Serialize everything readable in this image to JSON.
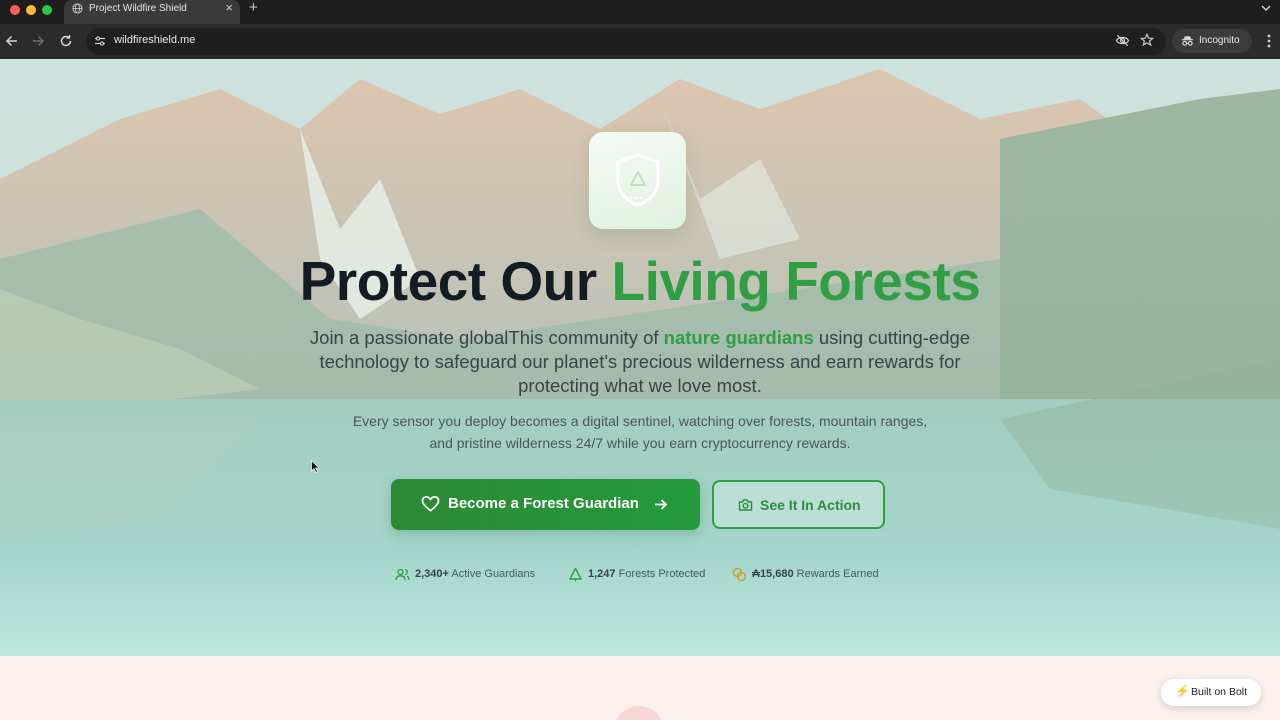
{
  "browser": {
    "tab_title": "Project Wildfire Shield",
    "url": "wildfireshield.me",
    "incognito_label": "Incognito",
    "icons": [
      "globe-icon",
      "close-icon",
      "plus-icon",
      "back-icon",
      "forward-icon",
      "reload-icon",
      "site-info-icon",
      "eye-off-icon",
      "star-icon",
      "incognito-icon",
      "more-icon"
    ]
  },
  "hero": {
    "title_part1": "Protect Our ",
    "title_part2": "Living Forests",
    "subtitle_before": "Join a passionate globalThis community of ",
    "subtitle_accent": "nature guardians",
    "subtitle_after": " using cutting-edge technology to safeguard our planet's precious wilderness and earn rewards for protecting what we love most.",
    "description": "Every sensor you deploy becomes a digital sentinel, watching over forests, mountain ranges, and pristine wilderness 24/7 while you earn cryptocurrency rewards.",
    "primary_button": "Become a Forest Guardian",
    "secondary_button": "See It In Action",
    "stats": [
      {
        "value": "2,340+",
        "label": "Active Guardians",
        "icon": "users-icon"
      },
      {
        "value": "1,247",
        "label": "Forests Protected",
        "icon": "tree-icon"
      },
      {
        "value": "₳15,680",
        "label": "Rewards Earned",
        "icon": "coins-icon"
      }
    ]
  },
  "badge": {
    "label": "Built on Bolt",
    "icon": "⚡"
  },
  "colors": {
    "accent_green": "#2f9e44",
    "button_green": "#2c8a35",
    "title_dark": "#131c22"
  }
}
